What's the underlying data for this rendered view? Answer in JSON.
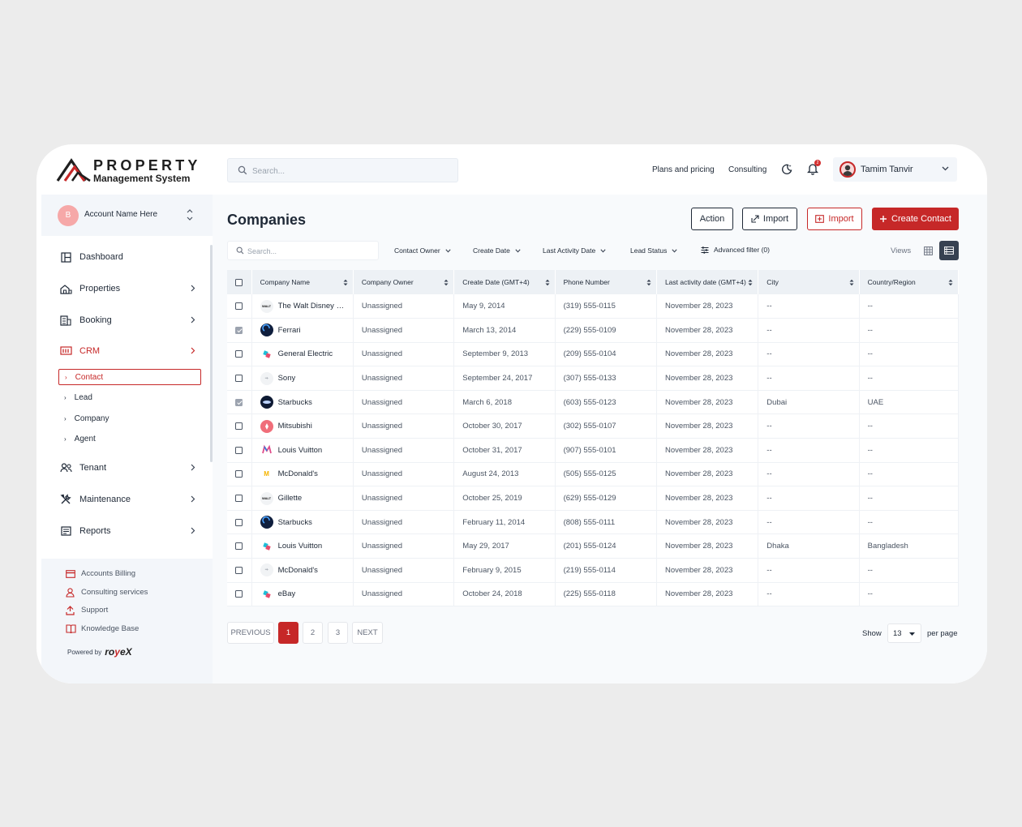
{
  "brand": {
    "line1": "PROPERTY",
    "line2": "Management System"
  },
  "topbar": {
    "search_placeholder": "Search...",
    "links": [
      "Plans and pricing",
      "Consulting"
    ],
    "notification_count": "2",
    "user_name": "Tamim Tanvir"
  },
  "account": {
    "initial": "B",
    "name": "Account Name Here"
  },
  "sidebar": {
    "items": [
      {
        "label": "Dashboard",
        "icon": "dashboard-icon"
      },
      {
        "label": "Properties",
        "icon": "properties-icon"
      },
      {
        "label": "Booking",
        "icon": "booking-icon"
      },
      {
        "label": "CRM",
        "icon": "crm-icon"
      },
      {
        "label": "Tenant",
        "icon": "tenant-icon"
      },
      {
        "label": "Maintenance",
        "icon": "maintenance-icon"
      },
      {
        "label": "Reports",
        "icon": "reports-icon"
      }
    ],
    "crm_sub": [
      "Contact",
      "Lead",
      "Company",
      "Agent"
    ],
    "bottom": [
      "Accounts Billing",
      "Consulting services",
      "Support",
      "Knowledge Base"
    ],
    "powered_by": "Powered by",
    "powered_brand_a": "ro",
    "powered_brand_b": "y",
    "powered_brand_c": "e",
    "powered_brand_d": "X"
  },
  "page": {
    "title": "Companies",
    "buttons": {
      "action": "Action",
      "import1": "Import",
      "import2": "Import",
      "create": "Create Contact"
    },
    "search_placeholder": "Search...",
    "filters": [
      "Contact Owner",
      "Create Date",
      "Last Activity Date",
      "Lead Status"
    ],
    "advanced_filter": "Advanced filter (0)",
    "views_label": "Views"
  },
  "table": {
    "columns": [
      "Company Name",
      "Company Owner",
      "Create Date (GMT+4)",
      "Phone Number",
      "Last activity date (GMT+4)",
      "City",
      "Country/Region"
    ],
    "rows": [
      {
        "checked": false,
        "company": "The Walt Disney C...",
        "owner": "Unassigned",
        "created": "May 9, 2014",
        "phone": "(319) 555-0115",
        "last": "November 28, 2023",
        "city": "--",
        "country": "--",
        "logo": "disney"
      },
      {
        "checked": true,
        "company": "Ferrari",
        "owner": "Unassigned",
        "created": "March 13, 2014",
        "phone": "(229) 555-0109",
        "last": "November 28, 2023",
        "city": "--",
        "country": "--",
        "logo": "ferrari"
      },
      {
        "checked": false,
        "company": "General Electric",
        "owner": "Unassigned",
        "created": "September 9, 2013",
        "phone": "(209) 555-0104",
        "last": "November 28, 2023",
        "city": "--",
        "country": "--",
        "logo": "ge"
      },
      {
        "checked": false,
        "company": "Sony",
        "owner": "Unassigned",
        "created": "September 24, 2017",
        "phone": "(307) 555-0133",
        "last": "November 28, 2023",
        "city": "--",
        "country": "--",
        "logo": "sony"
      },
      {
        "checked": true,
        "company": "Starbucks",
        "owner": "Unassigned",
        "created": "March 6, 2018",
        "phone": "(603) 555-0123",
        "last": "November 28, 2023",
        "city": "Dubai",
        "country": "UAE",
        "logo": "starbucks"
      },
      {
        "checked": false,
        "company": "Mitsubishi",
        "owner": "Unassigned",
        "created": "October 30, 2017",
        "phone": "(302) 555-0107",
        "last": "November 28, 2023",
        "city": "--",
        "country": "--",
        "logo": "mitsubishi"
      },
      {
        "checked": false,
        "company": "Louis Vuitton",
        "owner": "Unassigned",
        "created": "October 31, 2017",
        "phone": "(907) 555-0101",
        "last": "November 28, 2023",
        "city": "--",
        "country": "--",
        "logo": "lv"
      },
      {
        "checked": false,
        "company": "McDonald's",
        "owner": "Unassigned",
        "created": "August 24, 2013",
        "phone": "(505) 555-0125",
        "last": "November 28, 2023",
        "city": "--",
        "country": "--",
        "logo": "mcd"
      },
      {
        "checked": false,
        "company": "Gillette",
        "owner": "Unassigned",
        "created": "October 25, 2019",
        "phone": "(629) 555-0129",
        "last": "November 28, 2023",
        "city": "--",
        "country": "--",
        "logo": "disney"
      },
      {
        "checked": false,
        "company": "Starbucks",
        "owner": "Unassigned",
        "created": "February 11, 2014",
        "phone": "(808) 555-0111",
        "last": "November 28, 2023",
        "city": "--",
        "country": "--",
        "logo": "ferrari"
      },
      {
        "checked": false,
        "company": "Louis Vuitton",
        "owner": "Unassigned",
        "created": "May 29, 2017",
        "phone": "(201) 555-0124",
        "last": "November 28, 2023",
        "city": "Dhaka",
        "country": "Bangladesh",
        "logo": "ge"
      },
      {
        "checked": false,
        "company": "McDonald's",
        "owner": "Unassigned",
        "created": "February 9, 2015",
        "phone": "(219) 555-0114",
        "last": "November 28, 2023",
        "city": "--",
        "country": "--",
        "logo": "sony"
      },
      {
        "checked": false,
        "company": "eBay",
        "owner": "Unassigned",
        "created": "October 24, 2018",
        "phone": "(225) 555-0118",
        "last": "November 28, 2023",
        "city": "--",
        "country": "--",
        "logo": "ge"
      }
    ]
  },
  "pagination": {
    "previous": "PREVIOUS",
    "pages": [
      "1",
      "2",
      "3"
    ],
    "current": "1",
    "next": "NEXT",
    "show_label": "Show",
    "per_page_value": "13",
    "per_page_label": "per page"
  },
  "colors": {
    "accent": "#c62828",
    "dark": "#374151",
    "panel": "#f3f6fa"
  }
}
